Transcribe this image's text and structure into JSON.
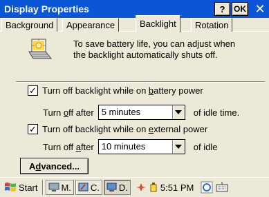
{
  "window": {
    "title": "Display Properties",
    "help_label": "?",
    "ok_label": "OK",
    "close_label": "✕"
  },
  "tabs": [
    {
      "label": "Background",
      "active": false
    },
    {
      "label": "Appearance",
      "active": false
    },
    {
      "label": "Backlight",
      "active": true
    },
    {
      "label": "Rotation",
      "active": false
    }
  ],
  "info": {
    "line1": "To save battery life, you can adjust when",
    "line2": "the backlight automatically shuts off."
  },
  "battery": {
    "checkbox_checked": true,
    "label_pre": "Turn off backlight while on ",
    "label_underlined": "b",
    "label_post": "attery power",
    "after_pre": "Turn ",
    "after_u": "o",
    "after_post": "ff after",
    "select_value": "5 minutes",
    "suffix": "of idle time."
  },
  "external": {
    "checkbox_checked": true,
    "label_pre": "Turn off backlight while on ",
    "label_underlined": "e",
    "label_post": "xternal power",
    "after_pre": "Turn off ",
    "after_u": "a",
    "after_post": "fter",
    "select_value": "10 minutes",
    "suffix": "of idle"
  },
  "advanced": {
    "pre": "A",
    "u": "d",
    "post": "vanced..."
  },
  "taskbar": {
    "start_label": "Start",
    "tasks": [
      "M.",
      "C.",
      "D."
    ],
    "clock": "5:51 PM"
  }
}
